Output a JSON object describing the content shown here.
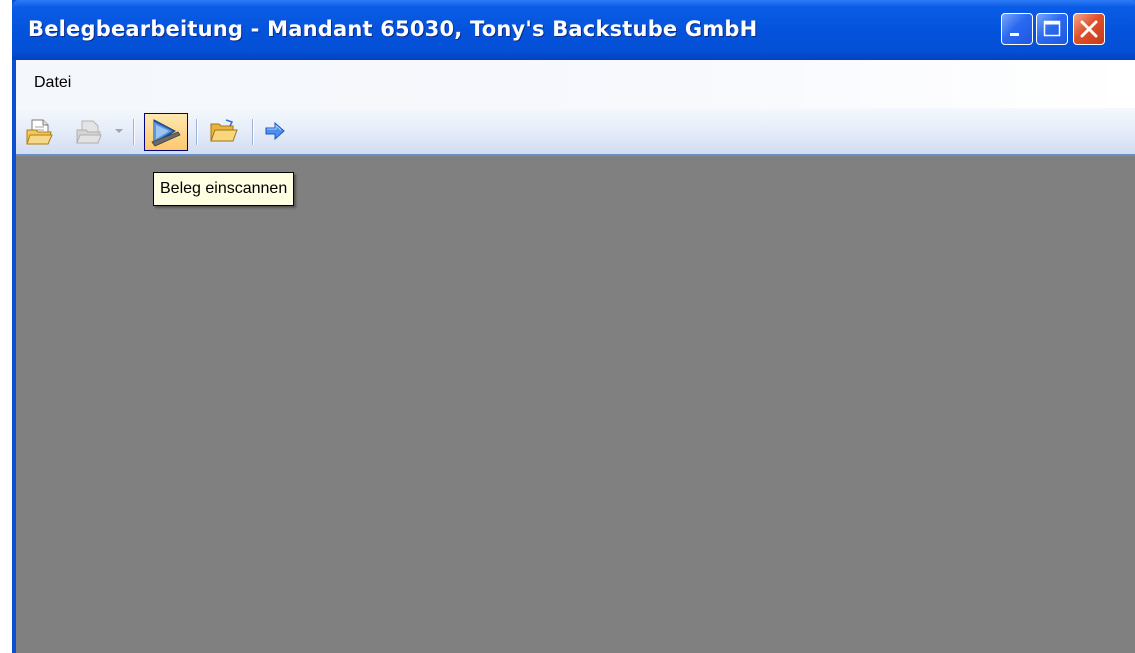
{
  "window": {
    "title": "Belegbearbeitung - Mandant 65030, Tony's Backstube GmbH",
    "controls": {
      "minimize_icon": "minimize-icon",
      "maximize_icon": "maximize-icon",
      "close_icon": "close-icon"
    },
    "accent_color": "#0453dc"
  },
  "menu": {
    "items": [
      {
        "label": "Datei"
      }
    ]
  },
  "toolbar": {
    "buttons": [
      {
        "icon": "open-document-icon",
        "enabled": true
      },
      {
        "icon": "document-dropdown-icon",
        "enabled": false,
        "has_dropdown": true
      },
      {
        "icon": "scan-document-icon",
        "enabled": true,
        "highlighted": true
      },
      {
        "icon": "open-folder-icon",
        "enabled": true
      },
      {
        "icon": "arrow-right-icon",
        "enabled": true
      }
    ]
  },
  "tooltip": {
    "text": "Beleg einscannen"
  },
  "client": {
    "background_color": "#808080"
  }
}
